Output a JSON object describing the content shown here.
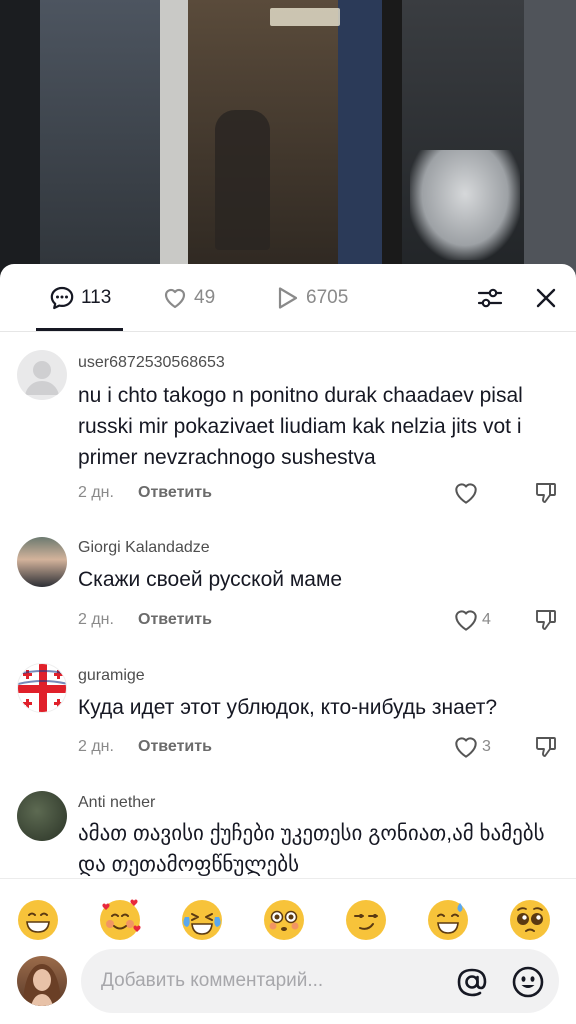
{
  "tabs": {
    "comments_count": "113",
    "likes_count": "49",
    "views_count": "6705"
  },
  "comments": [
    {
      "author": "user6872530568653",
      "text": "nu i chto takogo n ponitno durak chaadaev pisal russki mir pokazivaet liudiam kak nelzia jits vot i primer nevzrachnogo sushestva",
      "time": "2 дн.",
      "reply": "Ответить",
      "likes": ""
    },
    {
      "author": "Giorgi Kalandadze",
      "text": "Скажи своей русской маме",
      "time": "2 дн.",
      "reply": "Ответить",
      "likes": "4"
    },
    {
      "author": "guramige",
      "text": "Куда идет этот ублюдок, кто-нибудь знает?",
      "time": "2 дн.",
      "reply": "Ответить",
      "likes": "3"
    },
    {
      "author": "Anti nether",
      "text": "ამათ თავისი ქუჩები უკეთესი გონიათ,ამ ხამებს და თეთამოფწნულებს"
    }
  ],
  "emojis": [
    "grin-emoji",
    "smiling-hearts-emoji",
    "tears-of-joy-emoji",
    "flushed-emoji",
    "smirk-emoji",
    "sweat-smile-emoji",
    "pleading-emoji"
  ],
  "compose": {
    "placeholder": "Добавить комментарий..."
  },
  "colors": {
    "text": "#161823",
    "muted": "#8a8a8a",
    "emoji_yellow": "#f7c33a"
  }
}
